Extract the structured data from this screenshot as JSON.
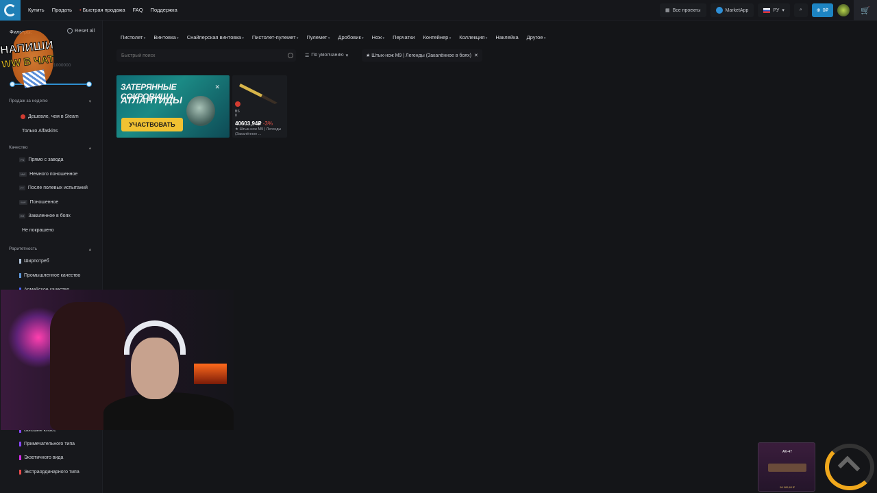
{
  "topbar": {
    "nav": [
      "Купить",
      "Продать",
      "Быстрая продажа",
      "FAQ",
      "Поддержка"
    ],
    "all_projects": "Все проекты",
    "marketapp": "MarketApp",
    "lang": "РУ",
    "balance": "0₽"
  },
  "sidebar": {
    "title": "Фильтры:",
    "reset": "Reset all",
    "price_max": "1000000",
    "sales_section": "Продаж за неделю",
    "sales_options": [
      "Дешевле, чем в Steam",
      "Только Alfaskins"
    ],
    "quality_section": "Качество",
    "quality_options": [
      {
        "tag": "FN",
        "label": "Прямо с завода"
      },
      {
        "tag": "MW",
        "label": "Немного поношенное"
      },
      {
        "tag": "FT",
        "label": "После полевых испытаний"
      },
      {
        "tag": "WW",
        "label": "Поношенное"
      },
      {
        "tag": "BS",
        "label": "Закаленное в боях"
      },
      {
        "tag": "",
        "label": "Не покрашено"
      }
    ],
    "rarity_section": "Раритетность",
    "rarity_options": [
      {
        "label": "Ширпотреб",
        "color": "#b0c3d9"
      },
      {
        "label": "Промышленное качество",
        "color": "#5e98d9"
      },
      {
        "label": "Армейское качество",
        "color": "#4b69ff"
      },
      {
        "label": "Высший класс",
        "color": "#8847ff"
      },
      {
        "label": "Примечательного типа",
        "color": "#8847ff"
      },
      {
        "label": "Экзотичного вида",
        "color": "#d32ce6"
      },
      {
        "label": "Экстраординарного типа",
        "color": "#eb4b4b"
      }
    ]
  },
  "categories": [
    "Пистолет",
    "Винтовка",
    "Снайперская винтовка",
    "Пистолет-пулемет",
    "Пулемет",
    "Дробовик",
    "Нож",
    "Перчатки",
    "Контейнер",
    "Коллекция",
    "Наклейка",
    "Другое"
  ],
  "search": {
    "placeholder": "Быстрый поиск"
  },
  "sort": {
    "label": "По умолчанию"
  },
  "active_filter": "★ Штык-нож M9 | Легенды (Закалённое в боях)",
  "banner": {
    "title_line1": "ЗАТЕРЯННЫЕ СОКРОВИЩА",
    "title_line2": "АТЛАНТИДЫ",
    "button": "УЧАСТВОВАТЬ"
  },
  "item": {
    "wear": "BS",
    "float": "0",
    "price": "40603,94₽",
    "discount": "-3%",
    "name": "★ Штык-нож M9 | Легенды (Закалённое ..."
  },
  "overlay": {
    "sticker_line1": "НАПИШИ",
    "sticker_line2": "WW В ЧАТ",
    "widget_item": "AK-47",
    "widget_price": "56 085,60 ₽"
  }
}
